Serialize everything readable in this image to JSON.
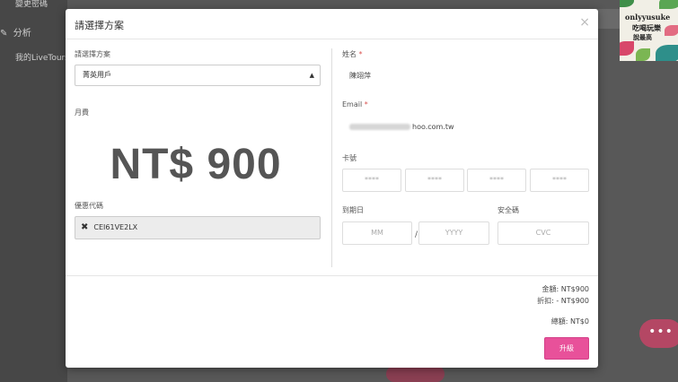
{
  "background": {
    "sidebar_items": [
      "變更密碼",
      "分析",
      "我的LiveTours"
    ],
    "bubble_label": "•••"
  },
  "logo": {
    "line1": "onlyyusuke",
    "line2": "吃喝玩樂",
    "line3": "說最高"
  },
  "modal": {
    "title": "請選擇方案",
    "close": "×",
    "plan": {
      "label": "請選擇方案",
      "selected": "菁英用戶",
      "fee_label": "月費",
      "price": "NT$ 900"
    },
    "coupon": {
      "label": "優惠代碼",
      "code": "CEI61VE2LX"
    },
    "name": {
      "label": "姓名",
      "required_mark": "*",
      "value": "陳翊萍"
    },
    "email": {
      "label": "Email",
      "required_mark": "*",
      "value_visible": "hoo.com.tw"
    },
    "card": {
      "label": "卡號",
      "placeholders": [
        "****",
        "****",
        "****",
        "****"
      ]
    },
    "expiry": {
      "label": "到期日",
      "month_placeholder": "MM",
      "separator": "/",
      "year_placeholder": "YYYY"
    },
    "cvc": {
      "label": "安全碼",
      "placeholder": "CVC"
    },
    "summary": {
      "amount": "金額: NT$900",
      "discount": "折扣: - NT$900",
      "total": "總額: NT$0"
    },
    "upgrade_button": "升級"
  },
  "colors": {
    "accent": "#e8519a",
    "required": "#d9534f"
  }
}
